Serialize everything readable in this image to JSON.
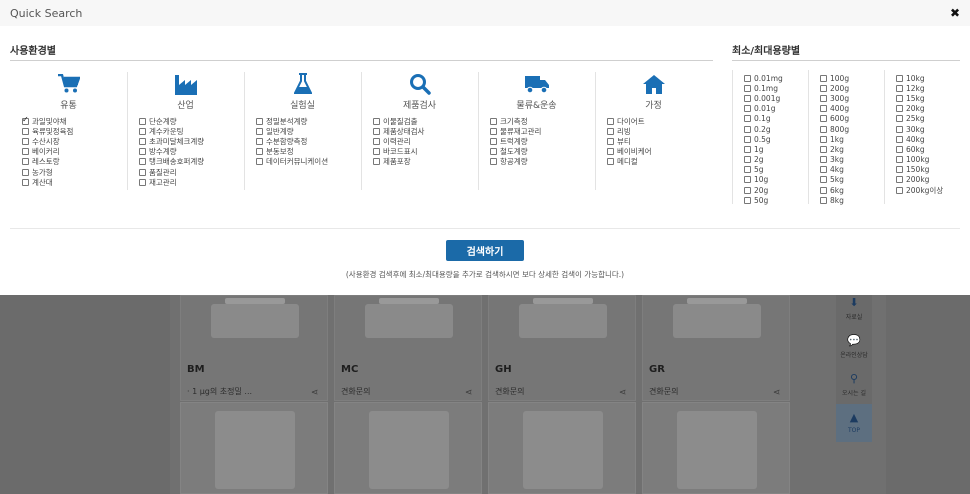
{
  "modal": {
    "title": "Quick Search",
    "close_label": "✖",
    "section_env": "사용환경별",
    "section_weight": "최소/최대용량별",
    "search_button": "검색하기",
    "note": "(사용환경 검색후에 최소/최대용량을 추가로 검색하시면 보다 상세한 검색이 가능합니다.)"
  },
  "categories": [
    {
      "label": "유통",
      "icon": "cart-icon",
      "items": [
        {
          "label": "과일및야채",
          "checked": true
        },
        {
          "label": "육류및정육점",
          "checked": false
        },
        {
          "label": "수산시장",
          "checked": false
        },
        {
          "label": "베이커리",
          "checked": false
        },
        {
          "label": "레스토랑",
          "checked": false
        },
        {
          "label": "농가형",
          "checked": false
        },
        {
          "label": "계산대",
          "checked": false
        }
      ]
    },
    {
      "label": "산업",
      "icon": "factory-icon",
      "items": [
        {
          "label": "단순계량",
          "checked": false
        },
        {
          "label": "계수카운팅",
          "checked": false
        },
        {
          "label": "초과미달체크계량",
          "checked": false
        },
        {
          "label": "방수계량",
          "checked": false
        },
        {
          "label": "탱크배송호퍼계량",
          "checked": false
        },
        {
          "label": "품질관리",
          "checked": false
        },
        {
          "label": "재고관리",
          "checked": false
        }
      ]
    },
    {
      "label": "실험실",
      "icon": "flask-icon",
      "items": [
        {
          "label": "정밀분석계량",
          "checked": false
        },
        {
          "label": "일반계량",
          "checked": false
        },
        {
          "label": "수분함량측정",
          "checked": false
        },
        {
          "label": "분동보정",
          "checked": false
        },
        {
          "label": "데이터커뮤니케이션",
          "checked": false
        }
      ]
    },
    {
      "label": "제품검사",
      "icon": "search-icon",
      "items": [
        {
          "label": "이물질검출",
          "checked": false
        },
        {
          "label": "제품상태검사",
          "checked": false
        },
        {
          "label": "이력관리",
          "checked": false
        },
        {
          "label": "바코드표시",
          "checked": false
        },
        {
          "label": "제품포장",
          "checked": false
        }
      ]
    },
    {
      "label": "물류&운송",
      "icon": "truck-icon",
      "items": [
        {
          "label": "크기측정",
          "checked": false
        },
        {
          "label": "물류재고관리",
          "checked": false
        },
        {
          "label": "트럭계량",
          "checked": false
        },
        {
          "label": "철도계량",
          "checked": false
        },
        {
          "label": "항공계량",
          "checked": false
        }
      ]
    },
    {
      "label": "가정",
      "icon": "home-icon",
      "items": [
        {
          "label": "다이어트",
          "checked": false
        },
        {
          "label": "리빙",
          "checked": false
        },
        {
          "label": "뷰티",
          "checked": false
        },
        {
          "label": "베이비케어",
          "checked": false
        },
        {
          "label": "메디컬",
          "checked": false
        }
      ]
    }
  ],
  "weights": [
    [
      "0.01mg",
      "0.1mg",
      "0.001g",
      "0.01g",
      "0.1g",
      "0.2g",
      "0.5g",
      "1g",
      "2g",
      "5g",
      "10g",
      "20g",
      "50g"
    ],
    [
      "100g",
      "200g",
      "300g",
      "400g",
      "600g",
      "800g",
      "1kg",
      "2kg",
      "3kg",
      "4kg",
      "5kg",
      "6kg",
      "8kg"
    ],
    [
      "10kg",
      "12kg",
      "15kg",
      "20kg",
      "25kg",
      "30kg",
      "40kg",
      "60kg",
      "100kg",
      "150kg",
      "200kg",
      "200kg이상"
    ]
  ],
  "background": {
    "products": [
      {
        "name": "BM",
        "desc": "· 1 µg의 초정밀 ..."
      },
      {
        "name": "MC",
        "desc": "견화문의"
      },
      {
        "name": "GH",
        "desc": "견화문의"
      },
      {
        "name": "GR",
        "desc": "견화문의"
      }
    ],
    "side_panel": [
      {
        "label": "자료실",
        "icon": "download-icon",
        "glyph": "⬇"
      },
      {
        "label": "온라인상담",
        "icon": "chat-icon",
        "glyph": "💬"
      },
      {
        "label": "오시는 길",
        "icon": "location-icon",
        "glyph": "⚲"
      },
      {
        "label": "TOP",
        "icon": "arrow-up-icon",
        "glyph": "▲"
      }
    ],
    "share_glyph": "⋖"
  },
  "colors": {
    "accent": "#1b6aa8",
    "icon_blue": "#1a6fb5",
    "overlay": "#6b6b6b"
  }
}
